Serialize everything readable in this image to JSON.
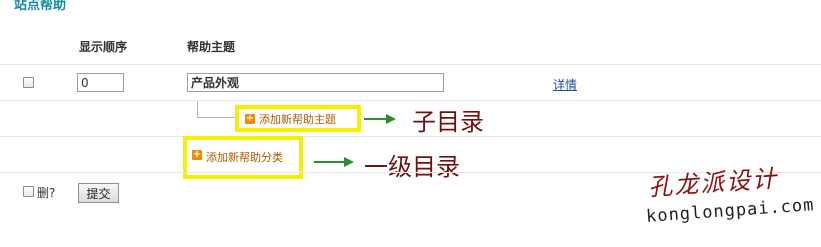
{
  "page_title": "站点帮助",
  "table": {
    "headers": {
      "order": "显示顺序",
      "topic": "帮助主题"
    },
    "row": {
      "order_value": "0",
      "topic_value": "产品外观",
      "detail_link": "详情"
    }
  },
  "actions": {
    "add_topic": "添加新帮助主题",
    "add_category": "添加新帮助分类",
    "delete_label": "删?",
    "submit_label": "提交"
  },
  "annotations": {
    "sub_dir": "子目录",
    "first_level_dir": "一级目录"
  },
  "watermark": {
    "cn": "孔龙派设计",
    "en": "konglongpai.com"
  },
  "colors": {
    "title": "#0f8ba3",
    "highlight": "#f5f000",
    "arrow": "#2e8b2e",
    "annotation": "#701010",
    "link": "#1f4f9c"
  }
}
